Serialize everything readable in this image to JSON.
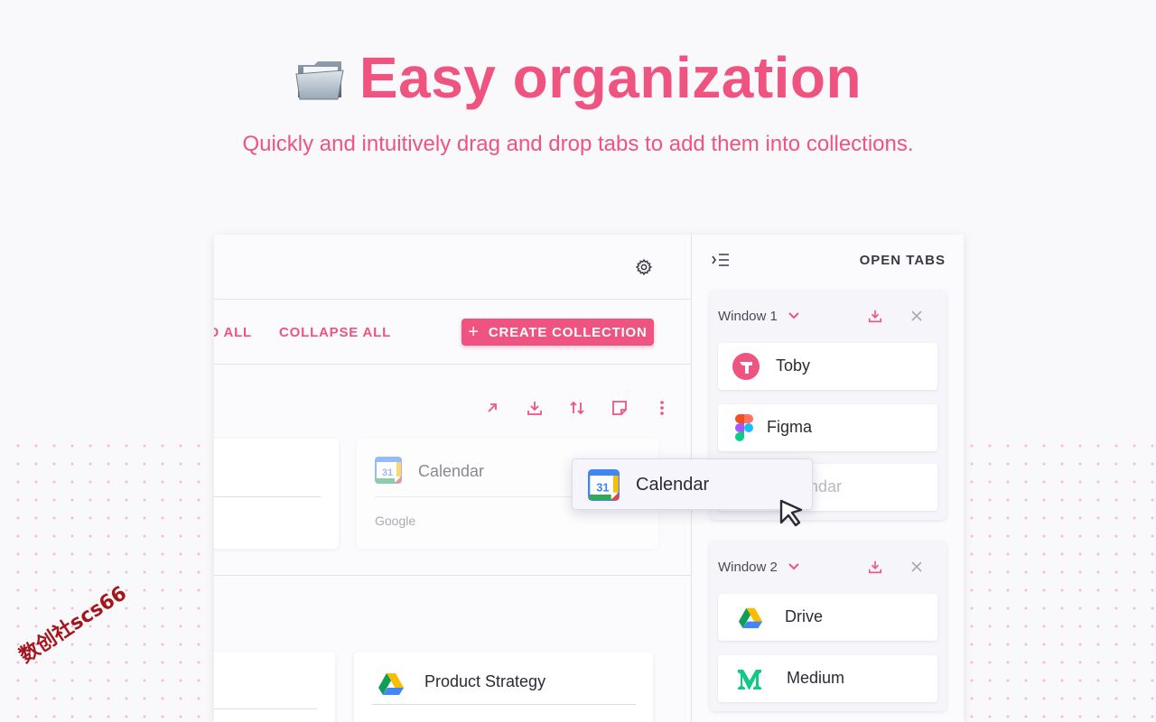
{
  "hero": {
    "title": "Easy organization",
    "subtitle": "Quickly and intuitively drag and drop tabs to add them into collections.",
    "icon": "folder-icon"
  },
  "main": {
    "settings_icon": "gear-icon",
    "actions": {
      "expand_all": "EXPAND ALL",
      "collapse_all": "COLLAPSE ALL",
      "create_collection": "CREATE COLLECTION"
    },
    "collection_icons": [
      "open-external-icon",
      "download-icon",
      "sort-icon",
      "note-icon",
      "more-vert-icon"
    ],
    "cards": [
      {
        "title": "",
        "subtitle": ""
      },
      {
        "title": "Calendar",
        "subtitle": "Google",
        "icon": "google-calendar-icon"
      },
      {
        "title": "",
        "subtitle": ""
      },
      {
        "title": "Product Strategy",
        "subtitle": "",
        "icon": "google-drive-icon"
      }
    ]
  },
  "sidebar": {
    "title": "OPEN TABS",
    "header_icon": "collapse-panel-icon",
    "windows": [
      {
        "name": "Window 1",
        "tabs": [
          {
            "label": "Toby",
            "icon": "toby-icon"
          },
          {
            "label": "Figma",
            "icon": "figma-icon"
          },
          {
            "label": "Calendar",
            "icon": "google-calendar-icon"
          }
        ]
      },
      {
        "name": "Window 2",
        "tabs": [
          {
            "label": "Drive",
            "icon": "google-drive-icon"
          },
          {
            "label": "Medium",
            "icon": "medium-icon"
          }
        ]
      }
    ]
  },
  "dragging": {
    "label": "Calendar",
    "icon": "google-calendar-icon"
  },
  "watermark": "数创社scs66",
  "colors": {
    "accent": "#ef5380",
    "background": "#f9f9fb"
  }
}
